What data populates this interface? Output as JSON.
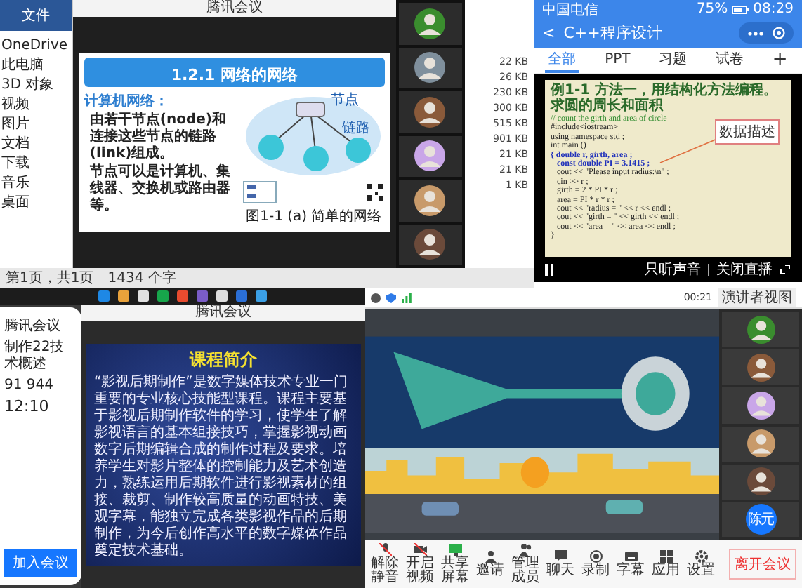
{
  "desktop_meeting": {
    "ribbon_tab": "文件",
    "explorer_items": [
      "OneDrive",
      "此电脑",
      "3D 对象",
      "视频",
      "图片",
      "文档",
      "下载",
      "音乐",
      "桌面"
    ],
    "window_title": "腾讯会议",
    "slide": {
      "header": "1.2.1 网络的网络",
      "heading": "计算机网络：",
      "bullets": [
        "由若干**节点**(node)和连接这些节点的**链路**(link)组成。",
        "**节点**可以是计算机、集线器、交换机或路由器等。"
      ],
      "diagram_labels": [
        "节点",
        "链路"
      ],
      "caption": "图1-1 (a) 简单的网络"
    },
    "file_sizes": [
      "22 KB",
      "26 KB",
      "230 KB",
      "300 KB",
      "515 KB",
      "901 KB",
      "21 KB",
      "21 KB",
      "1 KB"
    ],
    "status": [
      "第1页，共1页",
      "1434 个字"
    ]
  },
  "mobile_live": {
    "carrier": "中国电信",
    "battery": "75%",
    "time": "08:29",
    "back": "<",
    "title": "C++程序设计",
    "tabs": [
      {
        "label": "全部",
        "selected": true
      },
      {
        "label": "PPT",
        "selected": false
      },
      {
        "label": "习题",
        "selected": false
      },
      {
        "label": "试卷",
        "selected": false
      }
    ],
    "add": "+",
    "slide": {
      "title": "例1-1 方法一，用结构化方法编程。求圆的周长和面积",
      "callout": "数据描述",
      "code": [
        {
          "text": "// count the girth and area of circle",
          "kind": "comment"
        },
        {
          "text": "#include<iostream>",
          "kind": "plain"
        },
        {
          "text": "using namespace std ;",
          "kind": "plain"
        },
        {
          "text": "int main ()",
          "kind": "plain"
        },
        {
          "text": "{ double r, girth, area ;",
          "kind": "highlight"
        },
        {
          "text": "   const double PI = 3.1415 ;",
          "kind": "highlight"
        },
        {
          "text": "   cout << \"Please input radius:\\n\" ;",
          "kind": "plain"
        },
        {
          "text": "   cin >> r ;",
          "kind": "plain"
        },
        {
          "text": "   girth = 2 * PI * r ;",
          "kind": "plain"
        },
        {
          "text": "   area = PI * r * r ;",
          "kind": "plain"
        },
        {
          "text": "   cout << \"radius = \" << r << endl ;",
          "kind": "plain"
        },
        {
          "text": "   cout << \"girth = \" << girth << endl ;",
          "kind": "plain"
        },
        {
          "text": "   cout << \"area = \" << area << endl ;",
          "kind": "plain"
        },
        {
          "text": "}",
          "kind": "plain"
        }
      ]
    },
    "controls": [
      "只听声音",
      "关闭直播"
    ]
  },
  "shared_slide_meeting": {
    "phone": {
      "app": "腾讯会议",
      "topic": "制作22技术概述",
      "meeting_id": "91 944",
      "time": "12:10",
      "join": "加入会议"
    },
    "window_title": "腾讯会议",
    "slide": {
      "title": "课程简介",
      "body": "“影视后期制作”是数字媒体技术专业一门重要的专业核心技能型课程。课程主要基于影视后期制作软件的学习，使学生了解影视语言的基本组接技巧，掌握影视动画数字后期编辑合成的制作过程及要求。培养学生对影片整体的控制能力及艺术创造力，熟练运用后期软件进行影视素材的组接、裁剪、制作较高质量的动画特技、美观字幕，能独立完成各类影视作品的后期制作，为今后创作高水平的数字媒体作品奠定技术基础。"
    }
  },
  "video_meeting": {
    "timer": "00:21",
    "view": "演讲者视图",
    "avatar": "陈元",
    "toolbar": [
      {
        "label": "解除静音",
        "kind": "mic"
      },
      {
        "label": "开启视频",
        "kind": "camera"
      },
      {
        "label": "共享屏幕",
        "kind": "screen"
      },
      {
        "label": "邀请",
        "kind": "person"
      },
      {
        "label": "管理成员",
        "kind": "people"
      },
      {
        "label": "聊天",
        "kind": "chat"
      },
      {
        "label": "录制",
        "kind": "record"
      },
      {
        "label": "字幕",
        "kind": "captions"
      },
      {
        "label": "应用",
        "kind": "apps"
      },
      {
        "label": "设置",
        "kind": "gear"
      }
    ],
    "leave": "离开会议"
  }
}
